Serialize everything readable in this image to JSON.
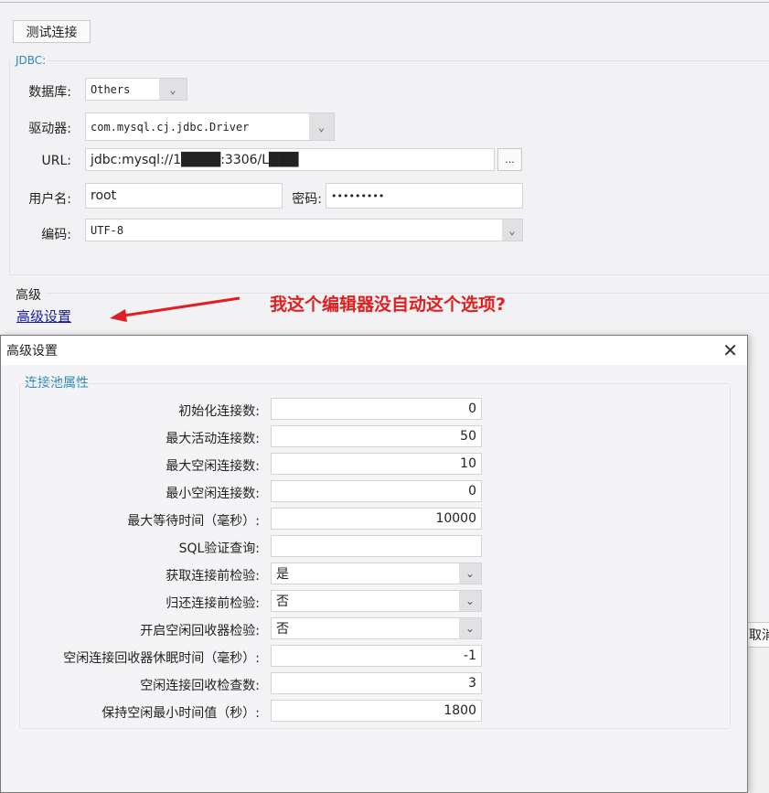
{
  "main": {
    "test_button": "测试连接",
    "jdbc_group": "JDBC:",
    "database_label": "数据库:",
    "database_value": "Others",
    "driver_label": "驱动器:",
    "driver_value": "com.mysql.cj.jdbc.Driver",
    "url_label": "URL:",
    "url_value": "jdbc:mysql://1████:3306/L███",
    "url_browse": "...",
    "user_label": "用户名:",
    "user_value": "root",
    "password_label": "密码:",
    "password_value": "•••••••••",
    "encoding_label": "编码:",
    "encoding_value": "UTF-8",
    "advanced_heading": "高级",
    "advanced_link": "高级设置",
    "annotation": "我这个编辑器没自动这个选项?",
    "cancel_partial": "取消"
  },
  "dialog": {
    "title": "高级设置",
    "group": "连接池属性",
    "rows": [
      {
        "label": "初始化连接数:",
        "value": "0"
      },
      {
        "label": "最大活动连接数:",
        "value": "50"
      },
      {
        "label": "最大空闲连接数:",
        "value": "10"
      },
      {
        "label": "最小空闲连接数:",
        "value": "0"
      },
      {
        "label": "最大等待时间（毫秒）:",
        "value": "10000"
      },
      {
        "label": "SQL验证查询:",
        "value": ""
      },
      {
        "label": "获取连接前检验:",
        "value": "是"
      },
      {
        "label": "归还连接前检验:",
        "value": "否"
      },
      {
        "label": "开启空闲回收器检验:",
        "value": "否"
      },
      {
        "label": "空闲连接回收器休眠时间（毫秒）:",
        "value": "-1"
      },
      {
        "label": "空闲连接回收检查数:",
        "value": "3"
      },
      {
        "label": "保持空闲最小时间值（秒）:",
        "value": "1800"
      }
    ]
  },
  "colors": {
    "link": "#1a1aa8",
    "annotation": "#e02020",
    "group_title": "#2a8ab8"
  }
}
